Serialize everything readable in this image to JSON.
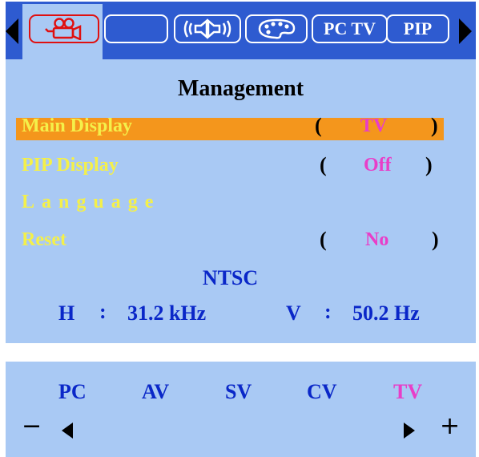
{
  "tabs": [
    {
      "name": "picture",
      "label": "",
      "icon": "camera-icon",
      "active": true
    },
    {
      "name": "blank",
      "label": "",
      "icon": "",
      "active": false
    },
    {
      "name": "sound",
      "label": "",
      "icon": "speaker-icon",
      "active": false
    },
    {
      "name": "color",
      "label": "",
      "icon": "palette-icon",
      "active": false
    },
    {
      "name": "pc-tv",
      "label": "PC TV",
      "icon": "",
      "active": false
    },
    {
      "name": "pip",
      "label": "PIP",
      "icon": "",
      "active": false
    }
  ],
  "menu": {
    "title": "Management",
    "items": [
      {
        "label": "Main Display",
        "value": "TV",
        "open": "(",
        "close": ")",
        "selected": true
      },
      {
        "label": "PIP Display",
        "value": "Off",
        "open": "(",
        "close": ")",
        "selected": false
      },
      {
        "label": "Language",
        "value": "",
        "open": "",
        "close": "",
        "selected": false
      },
      {
        "label": "Reset",
        "value": "No",
        "open": "(",
        "close": ")",
        "selected": false
      }
    ]
  },
  "signal": {
    "standard": "NTSC",
    "h_label": "H",
    "h_sep": ":",
    "h_value": "31.2 kHz",
    "v_label": "V",
    "v_sep": ":",
    "v_value": "50.2 Hz"
  },
  "sources": {
    "items": [
      "PC",
      "AV",
      "SV",
      "CV",
      "TV"
    ],
    "selected": "TV",
    "minus": "−",
    "plus": "+"
  },
  "colors": {
    "osd_bg": "#a9c9f4",
    "tab_bar": "#2e5bd0",
    "highlight": "#f4961c",
    "item_text": "#f4f04a",
    "value_text": "#e83ec8",
    "info_text": "#0a27c8"
  }
}
